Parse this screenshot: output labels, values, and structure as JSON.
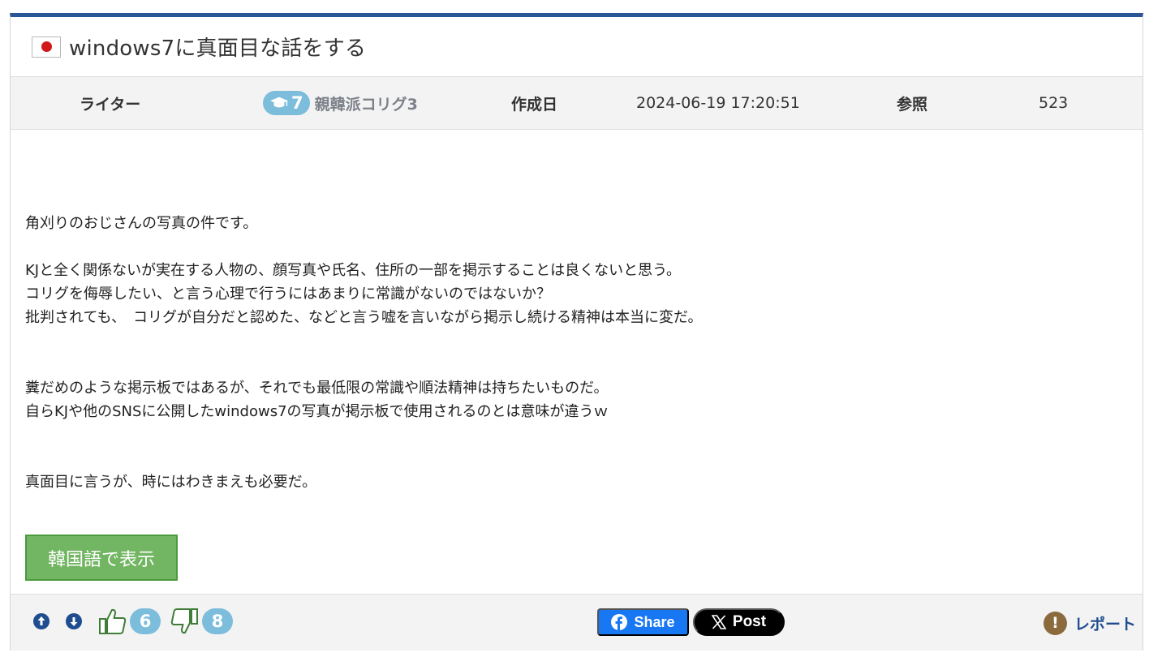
{
  "post": {
    "title": "windows7に真面目な話をする",
    "flag_icon": "japan-flag-icon"
  },
  "meta": {
    "writer_label": "ライター",
    "writer_level": "7",
    "writer_name": "親韓派コリグ3",
    "date_label": "作成日",
    "date_value": "2024-06-19 17:20:51",
    "views_label": "参照",
    "views_value": "523"
  },
  "content": {
    "paragraphs": [
      "角刈りのおじさんの写真の件です。",
      "",
      "KJと全く関係ないが実在する人物の、顔写真や氏名、住所の一部を掲示することは良くないと思う。",
      "コリグを侮辱したい、と言う心理で行うにはあまりに常識がないのではないか？",
      "批判されても、　コリグが自分だと認めた、などと言う嘘を言いながら掲示し続ける精神は本当に変だ。",
      "",
      "",
      "糞だめのような掲示板ではあるが、それでも最低限の常識や順法精神は持ちたいものだ。",
      "自らKJや他のSNSに公開したwindows7の写真が掲示板で使用されるのとは意味が違うｗ",
      "",
      "",
      "真面目に言うが、時にはわきまえも必要だ。"
    ]
  },
  "actions": {
    "translate_label": "韓国語で表示",
    "upvotes": "6",
    "downvotes": "8",
    "facebook_label": "Share",
    "x_label": "Post",
    "report_label": "レポート"
  },
  "colors": {
    "accent_bar": "#2a5597",
    "badge": "#7cbddc",
    "translate_button": "#72b562",
    "facebook": "#1877f2",
    "report_text": "#1f4d8f"
  }
}
